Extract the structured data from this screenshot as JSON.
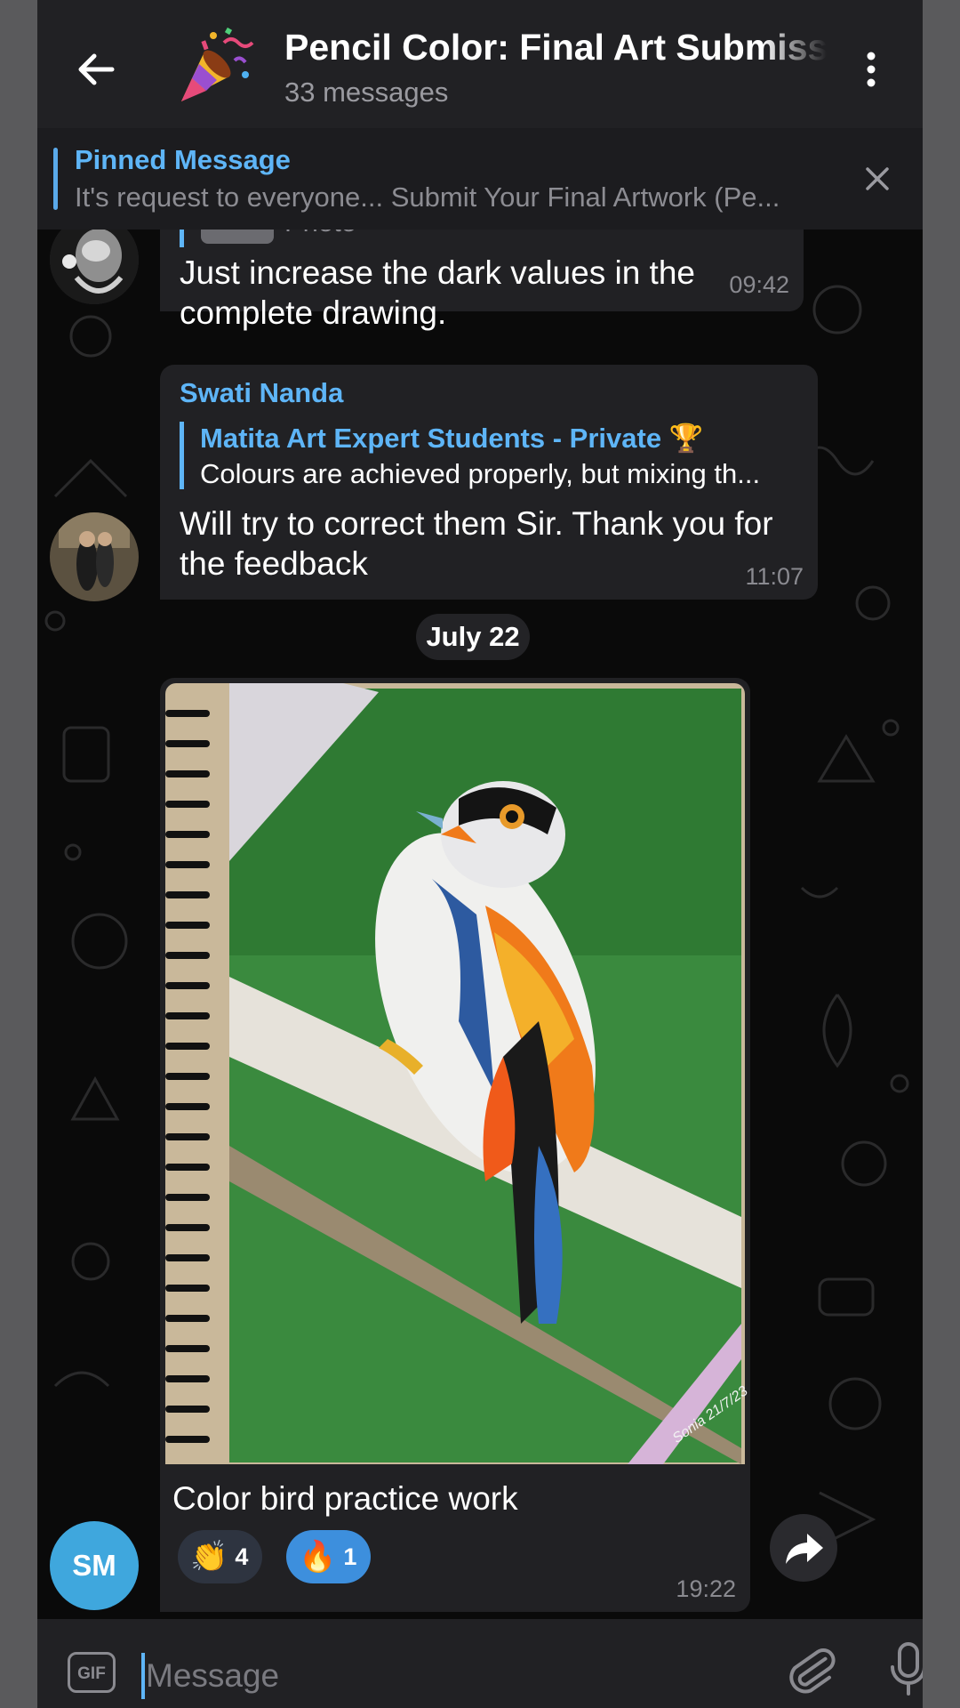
{
  "header": {
    "title": "Pencil Color: Final Art Submission",
    "subtitle": "33 messages"
  },
  "pinned": {
    "title": "Pinned Message",
    "text": "It's request to everyone... Submit Your Final Artwork (Pe..."
  },
  "messages": [
    {
      "partial_label": "Photo",
      "text": "Just increase the dark values in the complete drawing.",
      "time": "09:42"
    },
    {
      "sender": "Swati Nanda",
      "reply_title": "Matita Art Expert Students - Private 🏆",
      "reply_text": "Colours are achieved properly, but mixing th...",
      "text": "Will try to correct them Sir. Thank you for the feedback",
      "time": "11:07"
    }
  ],
  "date_separator": "July 22",
  "photo_message": {
    "signature": "Sonia 21/7/23",
    "caption": "Color bird practice work",
    "time": "19:22",
    "reactions": [
      {
        "emoji": "👏",
        "count": "4",
        "selected": false
      },
      {
        "emoji": "🔥",
        "count": "1",
        "selected": true
      }
    ],
    "sender_initials": "SM"
  },
  "composer": {
    "gif_label": "GIF",
    "placeholder": "Message"
  },
  "colors": {
    "accent": "#5eb5f7",
    "bubble": "#212124",
    "header": "#212124",
    "avatar_sm": "#3fa7dd"
  },
  "icons": [
    "back-arrow-icon",
    "party-popper-icon",
    "more-vertical-icon",
    "close-icon",
    "forward-icon",
    "gif-icon",
    "paperclip-icon",
    "microphone-icon"
  ]
}
